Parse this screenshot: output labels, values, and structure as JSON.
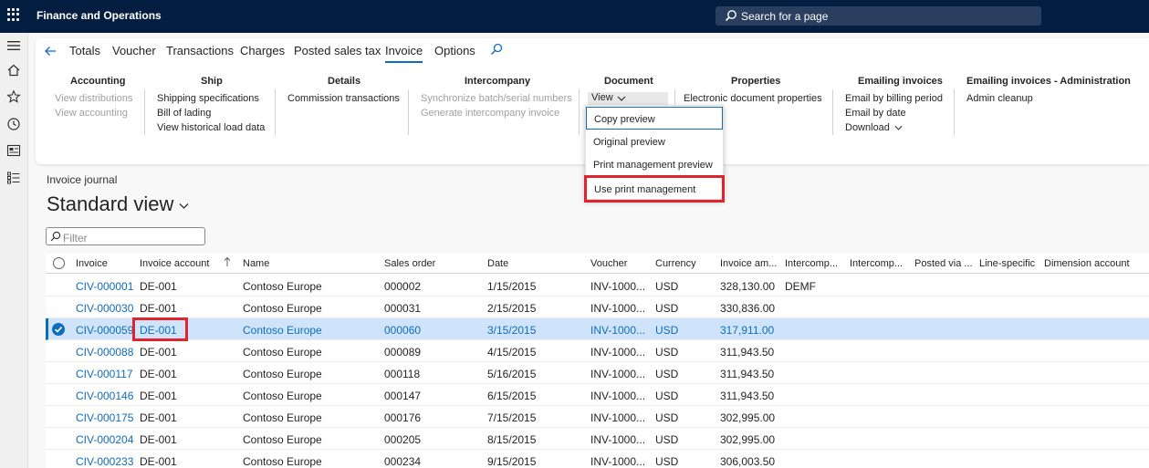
{
  "topbar": {
    "app_title": "Finance and Operations",
    "search_label": "Search for a page"
  },
  "action_tabs": [
    "Totals",
    "Voucher",
    "Transactions",
    "Charges",
    "Posted sales tax",
    "Invoice",
    "Options"
  ],
  "groups": {
    "accounting": {
      "title": "Accounting",
      "items": [
        "View distributions",
        "View accounting"
      ]
    },
    "ship": {
      "title": "Ship",
      "items": [
        "Shipping specifications",
        "Bill of lading",
        "View historical load data"
      ]
    },
    "details": {
      "title": "Details",
      "items": [
        "Commission transactions"
      ]
    },
    "intercompany": {
      "title": "Intercompany",
      "items": [
        "Synchronize batch/serial numbers",
        "Generate intercompany invoice"
      ]
    },
    "document": {
      "title": "Document",
      "view_label": "View"
    },
    "properties": {
      "title": "Properties",
      "items": [
        "Electronic document properties"
      ]
    },
    "emailing": {
      "title": "Emailing invoices",
      "items": [
        "Email by billing period",
        "Email by date",
        "Download"
      ]
    },
    "emailing_admin": {
      "title": "Emailing invoices - Administration",
      "items": [
        "Admin cleanup"
      ]
    }
  },
  "dropdown": [
    "Copy preview",
    "Original preview",
    "Print management preview",
    "Use print management"
  ],
  "content": {
    "journal_label": "Invoice journal",
    "view_title": "Standard view",
    "filter_placeholder": "Filter"
  },
  "grid": {
    "columns": [
      "Invoice",
      "Invoice account",
      "Name",
      "Sales order",
      "Date",
      "Voucher",
      "Currency",
      "Invoice am...",
      "Intercomp...",
      "Intercomp...",
      "Posted via ...",
      "Line-specific",
      "Dimension account"
    ],
    "rows": [
      [
        "CIV-000001",
        "DE-001",
        "Contoso Europe",
        "000002",
        "1/15/2015",
        "INV-1000...",
        "USD",
        "328,130.00",
        "DEMF"
      ],
      [
        "CIV-000030",
        "DE-001",
        "Contoso Europe",
        "000031",
        "2/15/2015",
        "INV-1000...",
        "USD",
        "330,836.00",
        ""
      ],
      [
        "CIV-000059",
        "DE-001",
        "Contoso Europe",
        "000060",
        "3/15/2015",
        "INV-1000...",
        "USD",
        "317,911.00",
        ""
      ],
      [
        "CIV-000088",
        "DE-001",
        "Contoso Europe",
        "000089",
        "4/15/2015",
        "INV-1000...",
        "USD",
        "311,943.50",
        ""
      ],
      [
        "CIV-000117",
        "DE-001",
        "Contoso Europe",
        "000118",
        "5/16/2015",
        "INV-1000...",
        "USD",
        "311,943.50",
        ""
      ],
      [
        "CIV-000146",
        "DE-001",
        "Contoso Europe",
        "000147",
        "6/15/2015",
        "INV-1000...",
        "USD",
        "311,943.50",
        ""
      ],
      [
        "CIV-000175",
        "DE-001",
        "Contoso Europe",
        "000176",
        "7/15/2015",
        "INV-1000...",
        "USD",
        "302,995.00",
        ""
      ],
      [
        "CIV-000204",
        "DE-001",
        "Contoso Europe",
        "000205",
        "8/15/2015",
        "INV-1000...",
        "USD",
        "302,995.00",
        ""
      ],
      [
        "CIV-000233",
        "DE-001",
        "Contoso Europe",
        "000234",
        "9/15/2015",
        "INV-1000...",
        "USD",
        "306,003.50",
        ""
      ]
    ],
    "selected_row_index": 2
  },
  "colors": {
    "topbar": "#041e42",
    "accent": "#0f6cbd",
    "selected_row": "#cfe4fa",
    "highlight_box": "#e0242b"
  }
}
